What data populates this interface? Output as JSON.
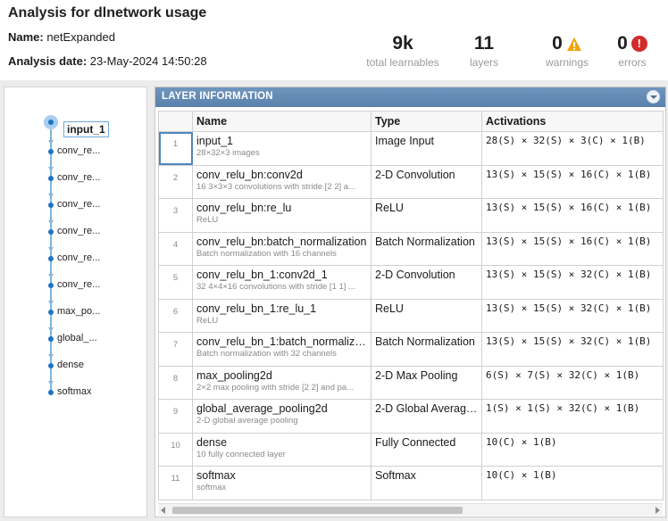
{
  "header": {
    "title": "Analysis for dlnetwork usage",
    "name_label": "Name:",
    "name_value": "netExpanded",
    "date_label": "Analysis date:",
    "date_value": "23-May-2024 14:50:28"
  },
  "stats": {
    "learnables": {
      "value": "9k",
      "label": "total learnables"
    },
    "layers": {
      "value": "11",
      "label": "layers"
    },
    "warnings": {
      "value": "0",
      "label": "warnings",
      "icon": "warning-triangle-icon"
    },
    "errors": {
      "value": "0",
      "label": "errors",
      "icon": "error-circle-icon"
    }
  },
  "graph": {
    "selected": "input_1",
    "nodes": [
      "conv_re...",
      "conv_re...",
      "conv_re...",
      "conv_re...",
      "conv_re...",
      "conv_re...",
      "max_po...",
      "global_...",
      "dense",
      "softmax"
    ]
  },
  "table": {
    "section_title": "LAYER INFORMATION",
    "columns": {
      "name": "Name",
      "type": "Type",
      "activations": "Activations"
    },
    "rows": [
      {
        "idx": "1",
        "name": "input_1",
        "desc": "28×32×3 images",
        "type": "Image Input",
        "act": "28(S) × 32(S) × 3(C) × 1(B)"
      },
      {
        "idx": "2",
        "name": "conv_relu_bn:conv2d",
        "desc": "16 3×3×3 convolutions with stride [2 2] a...",
        "type": "2-D Convolution",
        "act": "13(S) × 15(S) × 16(C) × 1(B)"
      },
      {
        "idx": "3",
        "name": "conv_relu_bn:re_lu",
        "desc": "ReLU",
        "type": "ReLU",
        "act": "13(S) × 15(S) × 16(C) × 1(B)"
      },
      {
        "idx": "4",
        "name": "conv_relu_bn:batch_normalization",
        "desc": "Batch normalization with 16 channels",
        "type": "Batch Normalization",
        "act": "13(S) × 15(S) × 16(C) × 1(B)"
      },
      {
        "idx": "5",
        "name": "conv_relu_bn_1:conv2d_1",
        "desc": "32 4×4×16 convolutions with stride [1 1] ...",
        "type": "2-D Convolution",
        "act": "13(S) × 15(S) × 32(C) × 1(B)"
      },
      {
        "idx": "6",
        "name": "conv_relu_bn_1:re_lu_1",
        "desc": "ReLU",
        "type": "ReLU",
        "act": "13(S) × 15(S) × 32(C) × 1(B)"
      },
      {
        "idx": "7",
        "name": "conv_relu_bn_1:batch_normalizatio...",
        "desc": "Batch normalization with 32 channels",
        "type": "Batch Normalization",
        "act": "13(S) × 15(S) × 32(C) × 1(B)"
      },
      {
        "idx": "8",
        "name": "max_pooling2d",
        "desc": "2×2 max pooling with stride [2 2] and pa...",
        "type": "2-D Max Pooling",
        "act": "6(S) × 7(S) × 32(C) × 1(B)"
      },
      {
        "idx": "9",
        "name": "global_average_pooling2d",
        "desc": "2-D global average pooling",
        "type": "2-D Global Average ...",
        "act": "1(S) × 1(S) × 32(C) × 1(B)"
      },
      {
        "idx": "10",
        "name": "dense",
        "desc": "10 fully connected layer",
        "type": "Fully Connected",
        "act": "10(C) × 1(B)"
      },
      {
        "idx": "11",
        "name": "softmax",
        "desc": "softmax",
        "type": "Softmax",
        "act": "10(C) × 1(B)"
      }
    ]
  },
  "colors": {
    "accent": "#1d74c2",
    "header_bar": "#6589b3",
    "warning": "#f0a30a",
    "error": "#d42b2b"
  }
}
